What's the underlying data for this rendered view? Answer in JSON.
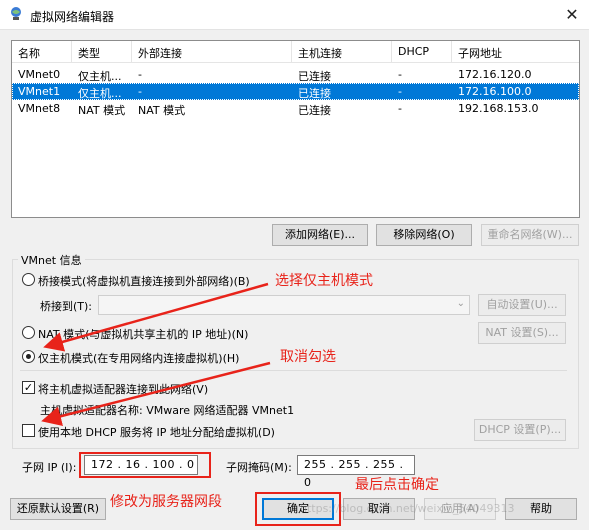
{
  "window": {
    "title": "虚拟网络编辑器",
    "close_glyph": "✕"
  },
  "table": {
    "headers": [
      "名称",
      "类型",
      "外部连接",
      "主机连接",
      "DHCP",
      "子网地址"
    ],
    "rows": [
      {
        "name": "VMnet0",
        "type": "仅主机...",
        "ext": "-",
        "host": "已连接",
        "dhcp": "-",
        "subnet": "172.16.120.0",
        "selected": false
      },
      {
        "name": "VMnet1",
        "type": "仅主机...",
        "ext": "-",
        "host": "已连接",
        "dhcp": "-",
        "subnet": "172.16.100.0",
        "selected": true
      },
      {
        "name": "VMnet8",
        "type": "NAT 模式",
        "ext": "NAT 模式",
        "host": "已连接",
        "dhcp": "-",
        "subnet": "192.168.153.0",
        "selected": false
      }
    ]
  },
  "list_buttons": {
    "add": "添加网络(E)...",
    "remove": "移除网络(O)",
    "rename": "重命名网络(W)..."
  },
  "vmnet_info": {
    "group_label": "VMnet 信息",
    "bridged_label": "桥接模式(将虚拟机直接连接到外部网络)(B)",
    "bridged_to_label": "桥接到(T):",
    "bridged_to_value": "",
    "auto_settings": "自动设置(U)...",
    "nat_label": "NAT 模式(与虚拟机共享主机的 IP 地址)(N)",
    "nat_settings": "NAT 设置(S)...",
    "hostonly_label": "仅主机模式(在专用网络内连接虚拟机)(H)",
    "connect_adapter_label": "将主机虚拟适配器连接到此网络(V)",
    "connect_adapter_checked": true,
    "adapter_name_label": "主机虚拟适配器名称: VMware 网络适配器 VMnet1",
    "dhcp_label": "使用本地 DHCP 服务将 IP 地址分配给虚拟机(D)",
    "dhcp_checked": false,
    "dhcp_settings": "DHCP 设置(P)...",
    "selected_mode": "hostonly"
  },
  "subnet": {
    "ip_label": "子网 IP (I):",
    "ip_value": "172 . 16 . 100 . 0",
    "mask_label": "子网掩码(M):",
    "mask_value": "255 . 255 . 255 . 0"
  },
  "footer_buttons": {
    "restore": "还原默认设置(R)",
    "ok": "确定",
    "cancel": "取消",
    "apply": "应用(A)",
    "help": "帮助"
  },
  "annotations": {
    "select_hostonly": "选择仅主机模式",
    "uncheck": "取消勾选",
    "change_segment": "修改为服务器网段",
    "click_ok": "最后点击确定"
  },
  "watermark": "https://blog.csdn.net/weixin_54049313",
  "colors": {
    "selection": "#0078d7",
    "annotation": "#e8231a"
  }
}
